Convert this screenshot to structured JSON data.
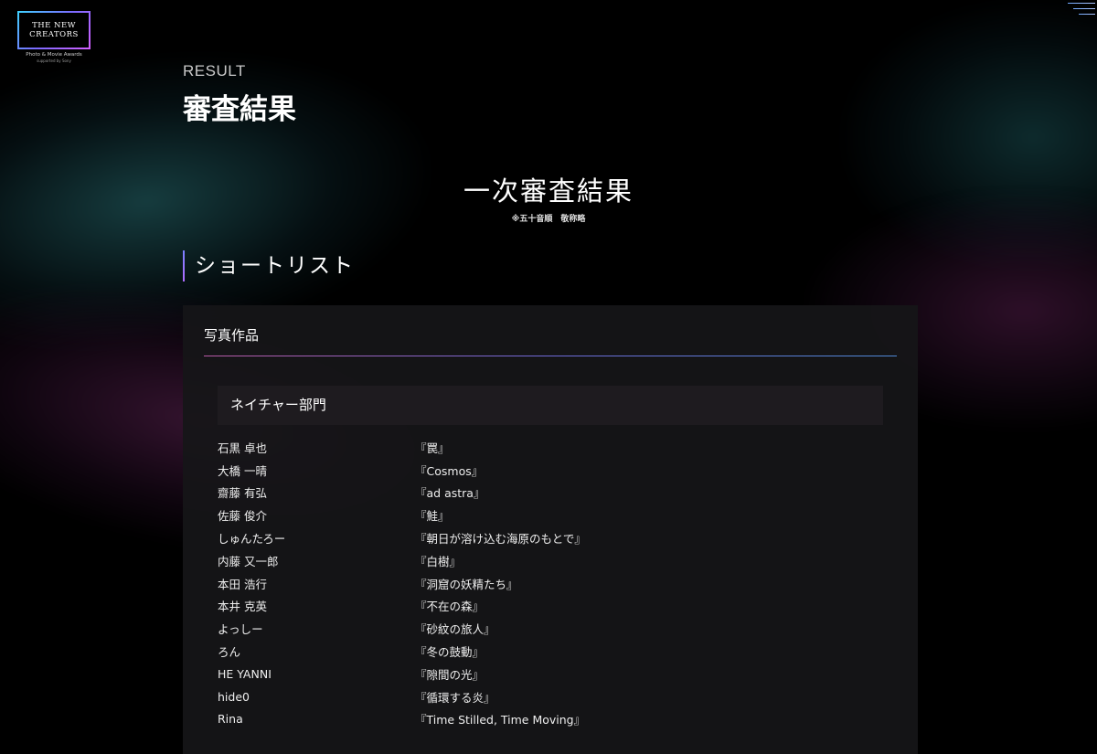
{
  "logo": {
    "text": "THE NEW\nCREATORS",
    "sub": "Photo & Movie Awards",
    "sub2": "supported by Sony"
  },
  "header": {
    "eyebrow": "RESULT",
    "title": "審査結果"
  },
  "section": {
    "title": "一次審査結果",
    "note": "※五十音順　敬称略"
  },
  "shortlist": {
    "label": "ショートリスト"
  },
  "card": {
    "title": "写真作品",
    "category": "ネイチャー部門",
    "entries": [
      {
        "name": "石黒 卓也",
        "work": "『罠』"
      },
      {
        "name": "大橋 一晴",
        "work": "『Cosmos』"
      },
      {
        "name": "齋藤 有弘",
        "work": "『ad astra』"
      },
      {
        "name": "佐藤 俊介",
        "work": "『鮭』"
      },
      {
        "name": "しゅんたろー",
        "work": "『朝日が溶け込む海原のもとで』"
      },
      {
        "name": "内藤 又一郎",
        "work": "『白樹』"
      },
      {
        "name": "本田 浩行",
        "work": "『洞窟の妖精たち』"
      },
      {
        "name": "本井 克英",
        "work": "『不在の森』"
      },
      {
        "name": "よっしー",
        "work": "『砂紋の旅人』"
      },
      {
        "name": "ろん",
        "work": "『冬の鼓動』"
      },
      {
        "name": "HE YANNI",
        "work": "『隙間の光』"
      },
      {
        "name": "hide0",
        "work": "『循環する炎』"
      },
      {
        "name": "Rina",
        "work": "『Time Stilled, Time Moving』"
      }
    ]
  },
  "icons": {
    "menu": "hamburger-menu-icon"
  },
  "colors": {
    "background": "#000000",
    "card": "#161618",
    "accent_blue": "#6e6ad8",
    "accent_pink": "#b85aa6"
  }
}
